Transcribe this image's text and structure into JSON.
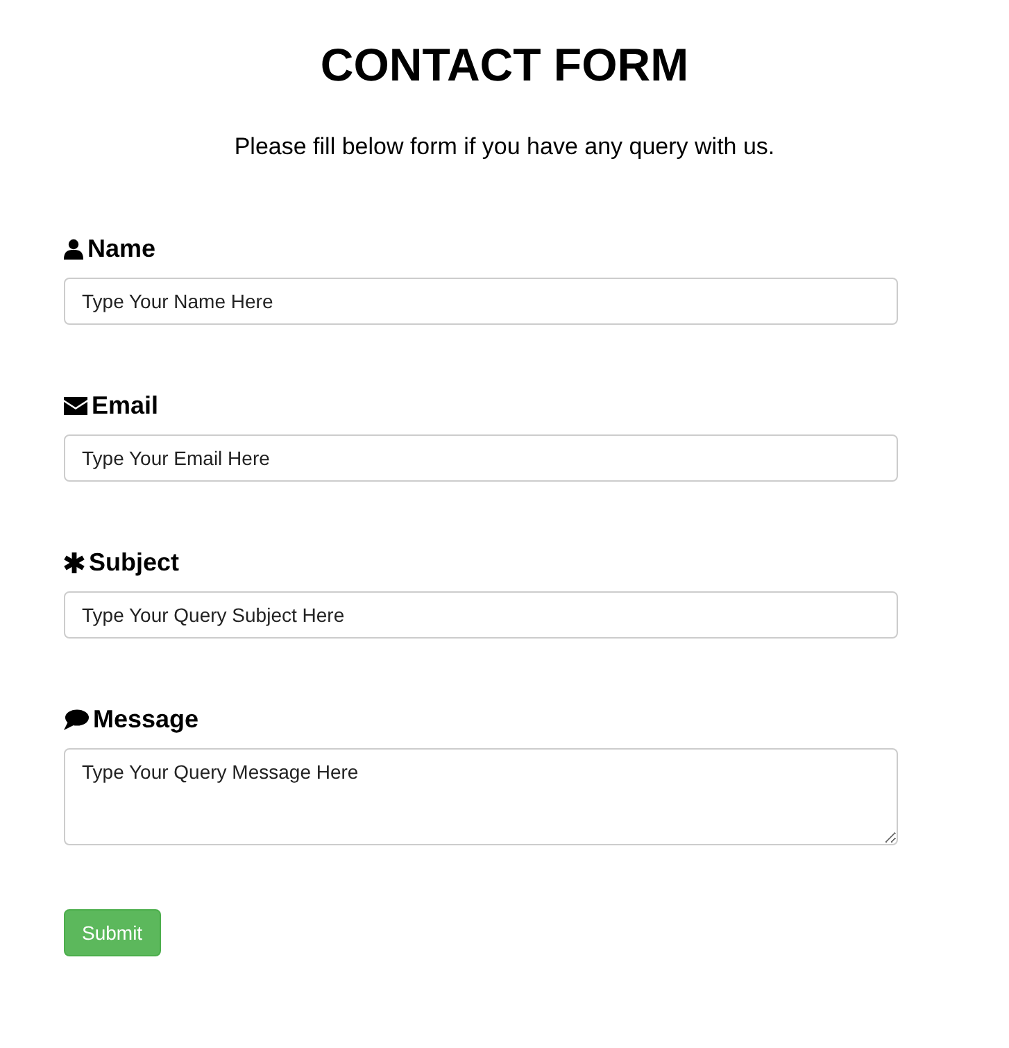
{
  "title": "CONTACT FORM",
  "subtitle": "Please fill below form if you have any query with us.",
  "fields": [
    {
      "label": "Name",
      "kind": "input",
      "placeholder": "Type Your Name Here"
    },
    {
      "label": "Email",
      "kind": "input",
      "placeholder": "Type Your Email Here"
    },
    {
      "label": "Subject",
      "kind": "input",
      "placeholder": "Type Your Query Subject Here"
    },
    {
      "label": "Message",
      "kind": "textarea",
      "placeholder": "Type Your Query Message Here"
    }
  ],
  "submit": "Submit"
}
